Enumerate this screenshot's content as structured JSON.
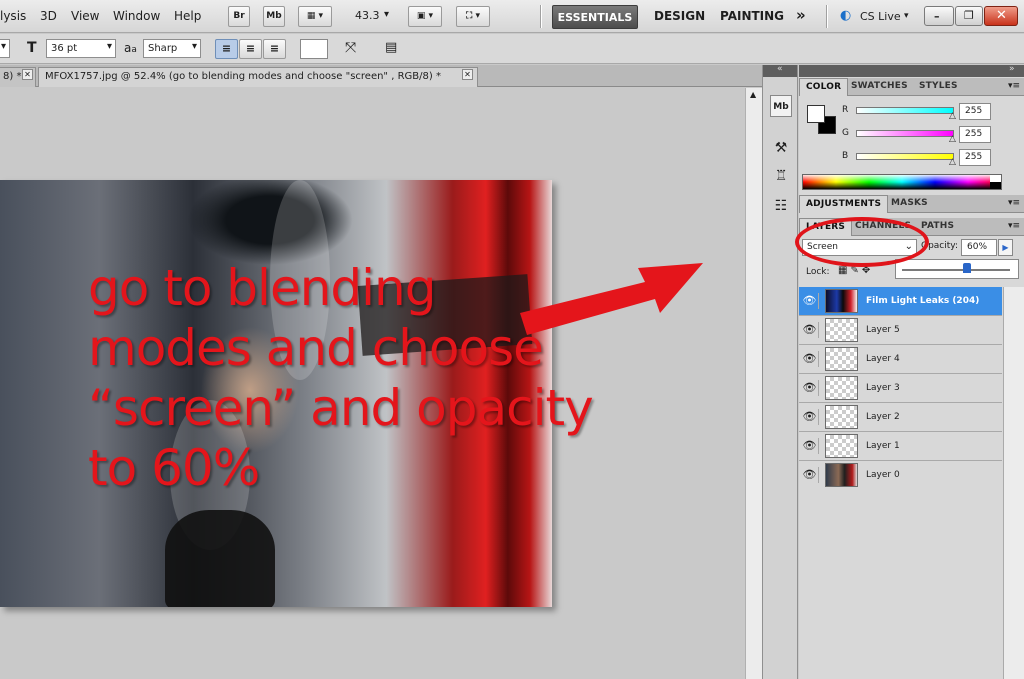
{
  "menubar": {
    "menus": [
      "lysis",
      "3D",
      "View",
      "Window",
      "Help"
    ],
    "bridge_label": "Br",
    "minibridge_label": "Mb",
    "zoom_value": "43.3",
    "workspaces": {
      "active": "ESSENTIALS",
      "design": "DESIGN",
      "painting": "PAINTING",
      "more": "»"
    },
    "cs_live": "CS Live"
  },
  "options": {
    "font_size": "36 pt",
    "aa_label": "a",
    "aa_small": "a",
    "antialias": "Sharp"
  },
  "tabs": {
    "prev_tab_fragment": "8) *",
    "doc_title": "MFOX1757.jpg @ 52.4% (go to blending modes and choose \"screen\" , RGB/8) *"
  },
  "annotation": {
    "lines": [
      "go to blending",
      "modes and choose",
      "“screen” and opacity",
      "to 60%"
    ]
  },
  "dock": {
    "minibridge_label": "Mb"
  },
  "color_panel": {
    "tabs": [
      "COLOR",
      "SWATCHES",
      "STYLES"
    ],
    "channels": [
      {
        "label": "R",
        "value": "255",
        "color": "#00ffff"
      },
      {
        "label": "G",
        "value": "255",
        "color": "#ff00ff"
      },
      {
        "label": "B",
        "value": "255",
        "color": "#ffff00"
      }
    ]
  },
  "adjust_panel": {
    "tabs": [
      "ADJUSTMENTS",
      "MASKS"
    ]
  },
  "layers_panel": {
    "tabs": [
      "LAYERS",
      "CHANNELS",
      "PATHS"
    ],
    "blend_mode": "Screen",
    "opacity_label": "Opacity:",
    "opacity_value": "60%",
    "opacity_fraction": 0.6,
    "lock_label": "Lock:",
    "layers": [
      {
        "name": "Film Light Leaks (204)",
        "selected": true
      },
      {
        "name": "Layer 5"
      },
      {
        "name": "Layer 4"
      },
      {
        "name": "Layer 3"
      },
      {
        "name": "Layer 2"
      },
      {
        "name": "Layer 1"
      },
      {
        "name": "Layer 0"
      }
    ]
  }
}
